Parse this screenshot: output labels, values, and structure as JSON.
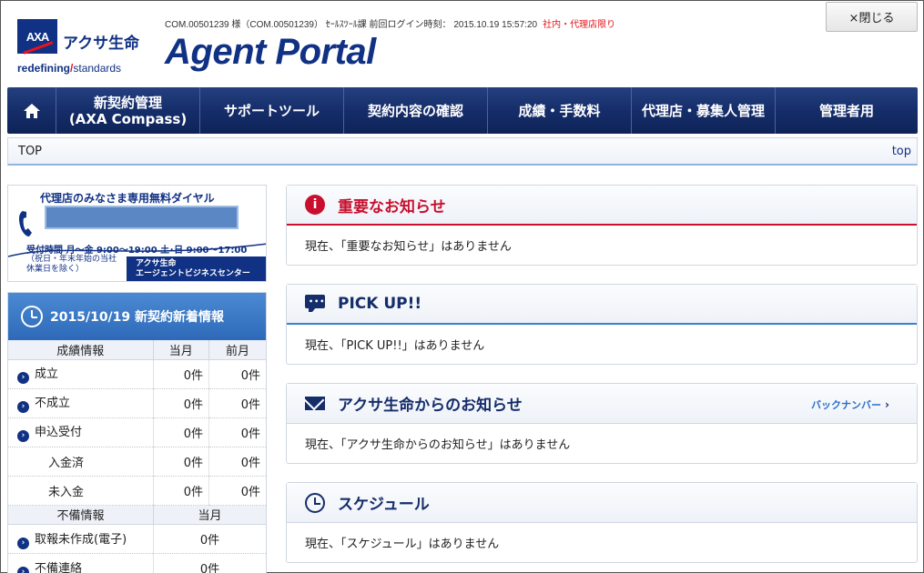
{
  "header": {
    "brand_mark": "AXA",
    "brand_name": "アクサ生命",
    "tagline_bold": "redefining",
    "tagline_slash": "/",
    "tagline_rest": "standards",
    "login_info": "COM.00501239 様（COM.00501239） ｾｰﾙｽﾂｰﾙ課  前回ログイン時刻： 2015.10.19 15:57:20",
    "restricted_label": "社内・代理店限り",
    "portal_title": "Agent Portal",
    "close_label": "×閉じる"
  },
  "nav": {
    "home_icon": "home-icon",
    "items": [
      {
        "label_line1": "新契約管理",
        "label_line2": "(AXA Compass)"
      },
      {
        "label_line1": "サポートツール",
        "label_line2": ""
      },
      {
        "label_line1": "契約内容の確認",
        "label_line2": ""
      },
      {
        "label_line1": "成績・手数料",
        "label_line2": ""
      },
      {
        "label_line1": "代理店・募集人管理",
        "label_line2": ""
      },
      {
        "label_line1": "管理者用",
        "label_line2": ""
      }
    ]
  },
  "breadcrumb": {
    "current": "TOP",
    "top_link": "top"
  },
  "dial": {
    "title": "代理店のみなさま専用無料ダイヤル",
    "hours": "受付時間  月～金 9:00～19:00  土･日 9:00～17:00",
    "note_line1": "（祝日・年末年始の当社",
    "note_line2": "  休業日を除く）",
    "center_line1": "アクサ生命",
    "center_line2": "エージェントビジネスセンター"
  },
  "info": {
    "title": "2015/10/19 新契約新着情報",
    "header1": {
      "c1": "成績情報",
      "c2": "当月",
      "c3": "前月"
    },
    "rows1": [
      {
        "label": "成立",
        "bullet": true,
        "cur": "0件",
        "prev": "0件"
      },
      {
        "label": "不成立",
        "bullet": true,
        "cur": "0件",
        "prev": "0件"
      },
      {
        "label": "申込受付",
        "bullet": true,
        "cur": "0件",
        "prev": "0件"
      },
      {
        "label": "入金済",
        "bullet": false,
        "cur": "0件",
        "prev": "0件"
      },
      {
        "label": "未入金",
        "bullet": false,
        "cur": "0件",
        "prev": "0件"
      }
    ],
    "header2": {
      "c1": "不備情報",
      "c2": "当月"
    },
    "rows2": [
      {
        "label": "取報未作成(電子)",
        "cur": "0件"
      },
      {
        "label": "不備連絡",
        "cur": "0件"
      }
    ]
  },
  "notices": [
    {
      "title": "重要なお知らせ",
      "body": "現在、「重要なお知らせ」はありません",
      "icon": "important-icon"
    },
    {
      "title": "PICK UP!!",
      "body": "現在、「PICK UP!!」はありません",
      "icon": "chat-icon"
    },
    {
      "title": "アクサ生命からのお知らせ",
      "body": "現在、「アクサ生命からのお知らせ」はありません",
      "icon": "mail-icon",
      "link": "バックナンバー"
    },
    {
      "title": "スケジュール",
      "body": "現在、「スケジュール」はありません",
      "icon": "schedule-icon"
    }
  ],
  "colors": {
    "brand_navy": "#103184",
    "accent_red": "#c8102e",
    "accent_blue": "#3a7fd1"
  }
}
